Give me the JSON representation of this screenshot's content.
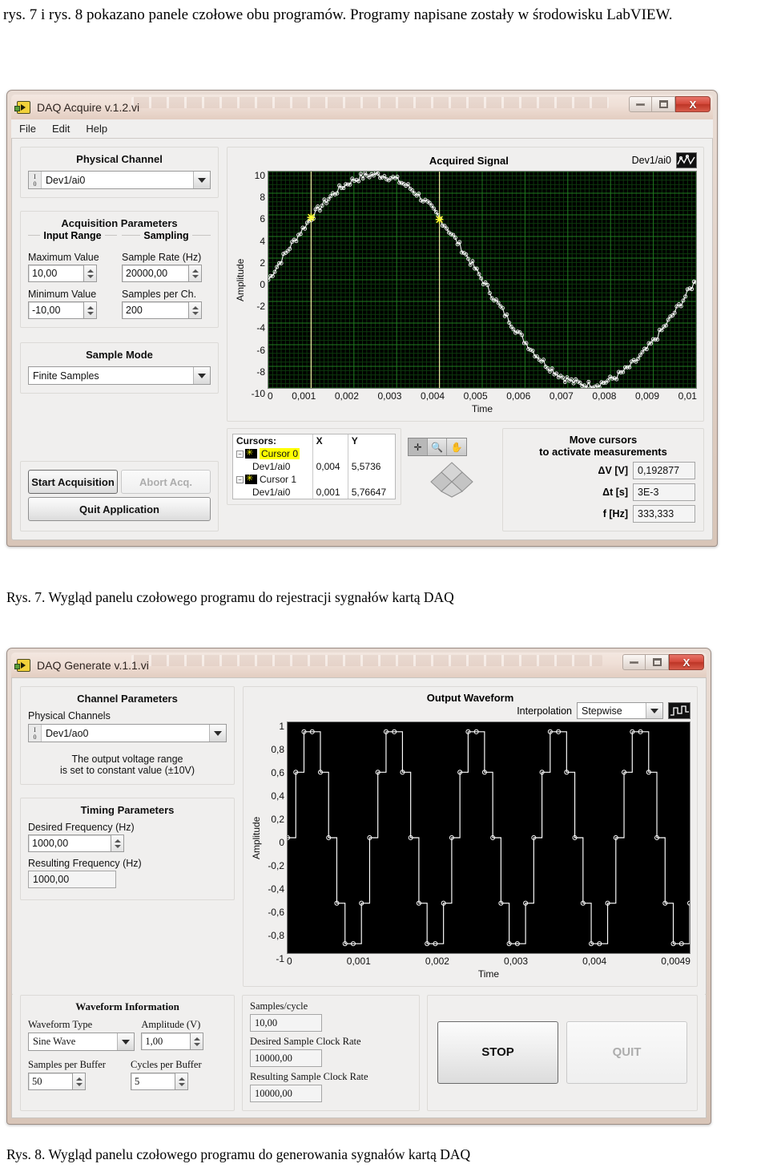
{
  "document": {
    "paragraph": "rys. 7 i rys. 8 pokazano panele czołowe obu programów. Programy napisane zostały w środowisku LabVIEW.",
    "caption_fig7": "Rys. 7. Wygląd panelu czołowego programu do rejestracji sygnałów kartą DAQ",
    "caption_fig8": "Rys. 8. Wygląd panelu czołowego programu do generowania sygnałów kartą DAQ"
  },
  "window_acquire": {
    "title": "DAQ Acquire v.1.2.vi",
    "menu": [
      "File",
      "Edit",
      "Help"
    ],
    "buttons": {
      "minimize": "minimize-icon",
      "maximize": "maximize-icon",
      "close": "X"
    },
    "physical_channel": {
      "title": "Physical Channel",
      "io_top": "I",
      "io_bottom": "0",
      "value": "Dev1/ai0"
    },
    "acquisition_parameters": {
      "title": "Acquisition Parameters",
      "input_range_label": "Input Range",
      "sampling_label": "Sampling",
      "maximum_value_label": "Maximum Value",
      "maximum_value": "10,00",
      "sample_rate_label": "Sample Rate (Hz)",
      "sample_rate": "20000,00",
      "minimum_value_label": "Minimum Value",
      "minimum_value": "-10,00",
      "samples_per_ch_label": "Samples per Ch.",
      "samples_per_ch": "200"
    },
    "sample_mode": {
      "title": "Sample Mode",
      "value": "Finite Samples"
    },
    "actions": {
      "start": "Start Acquisition",
      "abort": "Abort Acq.",
      "quit": "Quit Application"
    },
    "cursors": {
      "header_name": "Cursors:",
      "header_x": "X",
      "header_y": "Y",
      "rows": [
        {
          "name": "Cursor 0",
          "channel": "Dev1/ai0",
          "x": "0,004",
          "y": "5,5736"
        },
        {
          "name": "Cursor 1",
          "channel": "Dev1/ai0",
          "x": "0,001",
          "y": "5,76647"
        }
      ]
    },
    "measurements": {
      "hint_line1": "Move cursors",
      "hint_line2": "to activate measurements",
      "dv_label": "ΔV [V]",
      "dv_value": "0,192877",
      "dt_label": "Δt [s]",
      "dt_value": "3E-3",
      "f_label": "f [Hz]",
      "f_value": "333,333"
    }
  },
  "window_generate": {
    "title": "DAQ Generate v.1.1.vi",
    "buttons": {
      "minimize": "minimize-icon",
      "maximize": "maximize-icon",
      "close": "X"
    },
    "channel_parameters": {
      "title": "Channel Parameters",
      "physical_channels_label": "Physical Channels",
      "io_top": "I",
      "io_bottom": "0",
      "value": "Dev1/ao0",
      "note_line1": "The output voltage range",
      "note_line2": "is set to constant value (±10V)"
    },
    "timing_parameters": {
      "title": "Timing Parameters",
      "desired_frequency_label": "Desired Frequency (Hz)",
      "desired_frequency": "1000,00",
      "resulting_frequency_label": "Resulting Frequency (Hz)",
      "resulting_frequency": "1000,00"
    },
    "waveform_information": {
      "title": "Waveform Information",
      "waveform_type_label": "Waveform Type",
      "waveform_type": "Sine Wave",
      "amplitude_label": "Amplitude (V)",
      "amplitude": "1,00",
      "samples_per_buffer_label": "Samples per Buffer",
      "samples_per_buffer": "50",
      "cycles_per_buffer_label": "Cycles per Buffer",
      "cycles_per_buffer": "5"
    },
    "clock": {
      "samples_per_cycle_label": "Samples/cycle",
      "samples_per_cycle": "10,00",
      "desired_sample_clock_label": "Desired Sample Clock Rate",
      "desired_sample_clock": "10000,00",
      "resulting_sample_clock_label": "Resulting Sample Clock Rate",
      "resulting_sample_clock": "10000,00"
    },
    "actions": {
      "stop": "STOP",
      "quit": "QUIT"
    },
    "interpolation": {
      "label": "Interpolation",
      "value": "Stepwise"
    }
  },
  "chart_data": [
    {
      "type": "line",
      "title": "Acquired Signal",
      "legend": [
        "Dev1/ai0"
      ],
      "xlabel": "Time",
      "ylabel": "Amplitude",
      "xlim": [
        0,
        0.01
      ],
      "ylim": [
        -10,
        10
      ],
      "xticks": [
        "0",
        "0,001",
        "0,002",
        "0,003",
        "0,004",
        "0,005",
        "0,006",
        "0,007",
        "0,008",
        "0,009",
        "0,01"
      ],
      "yticks": [
        "10",
        "8",
        "6",
        "4",
        "2",
        "0",
        "-2",
        "-4",
        "-6",
        "-8",
        "-10"
      ],
      "grid": true,
      "grid_color": "#1f6b1f",
      "plot_bg": "#000000",
      "trace_color": "#ffffff",
      "description": "Noisy sine wave, amplitude ~9.7 V, one full period over 0..0.01 s, ~200 sample markers",
      "signal": {
        "amplitude": 9.7,
        "frequency_hz": 100,
        "phase_deg": 0,
        "noise": 0.35,
        "n_points": 200
      },
      "cursors": [
        {
          "name": "Cursor 0",
          "x": 0.004,
          "y": 5.5736,
          "color": "#e8e8a0"
        },
        {
          "name": "Cursor 1",
          "x": 0.001,
          "y": 5.76647,
          "color": "#e8e8a0"
        }
      ]
    },
    {
      "type": "line",
      "title": "Output Waveform",
      "xlabel": "Time",
      "ylabel": "Amplitude",
      "xlim": [
        0,
        0.0049
      ],
      "ylim": [
        -1,
        1
      ],
      "xticks": [
        "0",
        "0,001",
        "0,002",
        "0,003",
        "0,004",
        "0,0049"
      ],
      "yticks": [
        "1",
        "0,8",
        "0,6",
        "0,4",
        "0,2",
        "0",
        "-0,2",
        "-0,4",
        "-0,6",
        "-0,8",
        "-1"
      ],
      "grid": false,
      "plot_bg": "#000000",
      "trace_color": "#ffffff",
      "interpolation": "Stepwise",
      "description": "Stepwise-interpolated sine wave, 5 cycles, 10 samples per cycle, amplitude 1 V",
      "signal": {
        "amplitude": 1.0,
        "cycles": 5,
        "samples_per_cycle": 10,
        "n_points": 50
      },
      "sample_values": [
        0,
        0.588,
        0.951,
        0.951,
        0.588,
        0,
        -0.588,
        -0.951,
        -0.951,
        -0.588
      ]
    }
  ]
}
